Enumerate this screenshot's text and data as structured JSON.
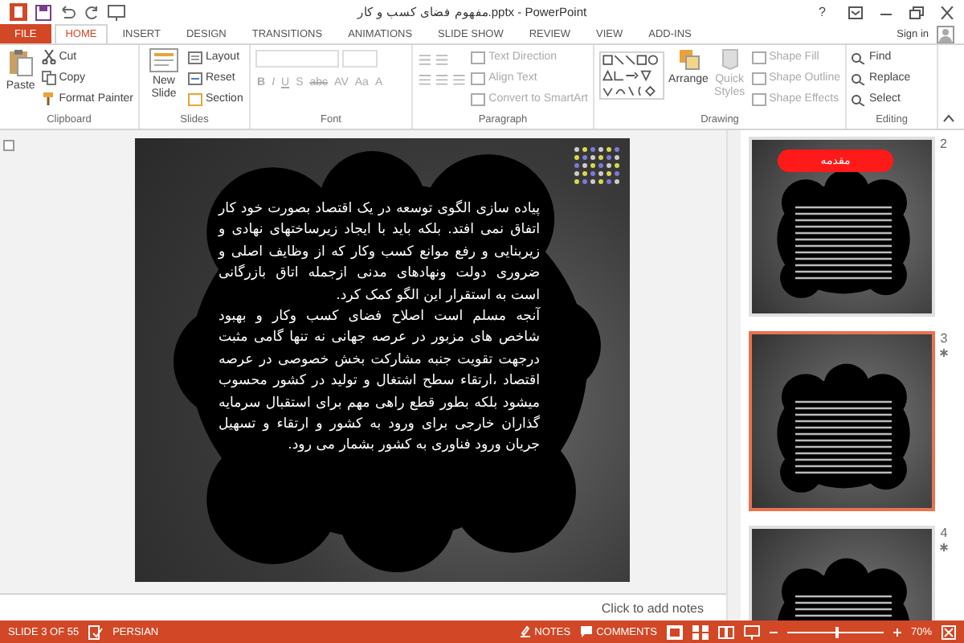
{
  "window": {
    "title": "مفهوم فضای کسب و کار.pptx - PowerPoint",
    "help": "?",
    "sign_in": "Sign in"
  },
  "tabs": [
    {
      "label": "FILE",
      "kind": "file",
      "selected": false
    },
    {
      "label": "HOME",
      "kind": "tab",
      "selected": true
    },
    {
      "label": "INSERT",
      "kind": "tab",
      "selected": false
    },
    {
      "label": "DESIGN",
      "kind": "tab",
      "selected": false
    },
    {
      "label": "TRANSITIONS",
      "kind": "tab",
      "selected": false
    },
    {
      "label": "ANIMATIONS",
      "kind": "tab",
      "selected": false
    },
    {
      "label": "SLIDE SHOW",
      "kind": "tab",
      "selected": false
    },
    {
      "label": "REVIEW",
      "kind": "tab",
      "selected": false
    },
    {
      "label": "VIEW",
      "kind": "tab",
      "selected": false
    },
    {
      "label": "ADD-INS",
      "kind": "tab",
      "selected": false
    }
  ],
  "ribbon": {
    "clipboard": {
      "label": "Clipboard",
      "paste": "Paste",
      "cut": "Cut",
      "copy": "Copy",
      "format_painter": "Format Painter"
    },
    "slides": {
      "label": "Slides",
      "new_slide": "New Slide",
      "layout": "Layout",
      "reset": "Reset",
      "section": "Section"
    },
    "font": {
      "label": "Font",
      "disabled": true,
      "bold": "B",
      "italic": "I",
      "underline": "U",
      "strike": "S",
      "shadow": "abc",
      "spacing": "AV",
      "case": "Aa",
      "font_color": "A"
    },
    "paragraph": {
      "label": "Paragraph",
      "items": [
        {
          "label": "Text Direction",
          "disabled": true
        },
        {
          "label": "Align Text",
          "disabled": true
        },
        {
          "label": "Convert to SmartArt",
          "disabled": true
        }
      ]
    },
    "drawing": {
      "label": "Drawing",
      "arrange": {
        "label": "Arrange",
        "disabled": false
      },
      "quick_styles": {
        "label": "Quick Styles",
        "disabled": true
      },
      "items": [
        {
          "label": "Shape Fill",
          "disabled": true
        },
        {
          "label": "Shape Outline",
          "disabled": true
        },
        {
          "label": "Shape Effects",
          "disabled": true
        }
      ]
    },
    "editing": {
      "label": "Editing",
      "items": [
        {
          "label": "Find",
          "disabled": false
        },
        {
          "label": "Replace",
          "disabled": false
        },
        {
          "label": "Select",
          "disabled": false
        }
      ]
    }
  },
  "slide": {
    "paragraphs": [
      "پیاده سازی الگوی توسعه در یک اقتصاد بصورت خود کار اتفاق نمی افتد. بلکه باید با ایجاد زیرساختهای نهادی و زیربنایی و رفع موانع کسب وکار  که از وظایف اصلی  و ضروری دولت ونهادهای مدنی ازجمله اتاق بازرگانی است به استقرار این الگو کمک کرد.",
      "آنجه مسلم است اصلاح فضای کسب وکار و بهبود شاخص های مزبور در عرصه جهانی نه تنها گامی مثبت درجهت تقویت جنبه مشارکت  بخش خصوصی در عرصه اقتصاد ،ارتقاء سطح اشتغال و تولید در کشور محسوب میشود بلکه بطور قطع راهی مهم برای استقبال سرمایه گذاران  خارجی برای ورود به کشور و ارتقاء و تسهیل جریان ورود فناوری به کشور بشمار می رود."
    ]
  },
  "notes": {
    "placeholder": "Click to add notes"
  },
  "thumbnails": [
    {
      "number": "2",
      "selected": false,
      "animated": false,
      "title": "مقدمه"
    },
    {
      "number": "3",
      "selected": true,
      "animated": true
    },
    {
      "number": "4",
      "selected": false,
      "animated": true
    }
  ],
  "status_bar": {
    "slide": "SLIDE 3 OF 55",
    "language": "PERSIAN",
    "notes": "NOTES",
    "comments": "COMMENTS",
    "zoom": "70%",
    "level": 0.5
  }
}
